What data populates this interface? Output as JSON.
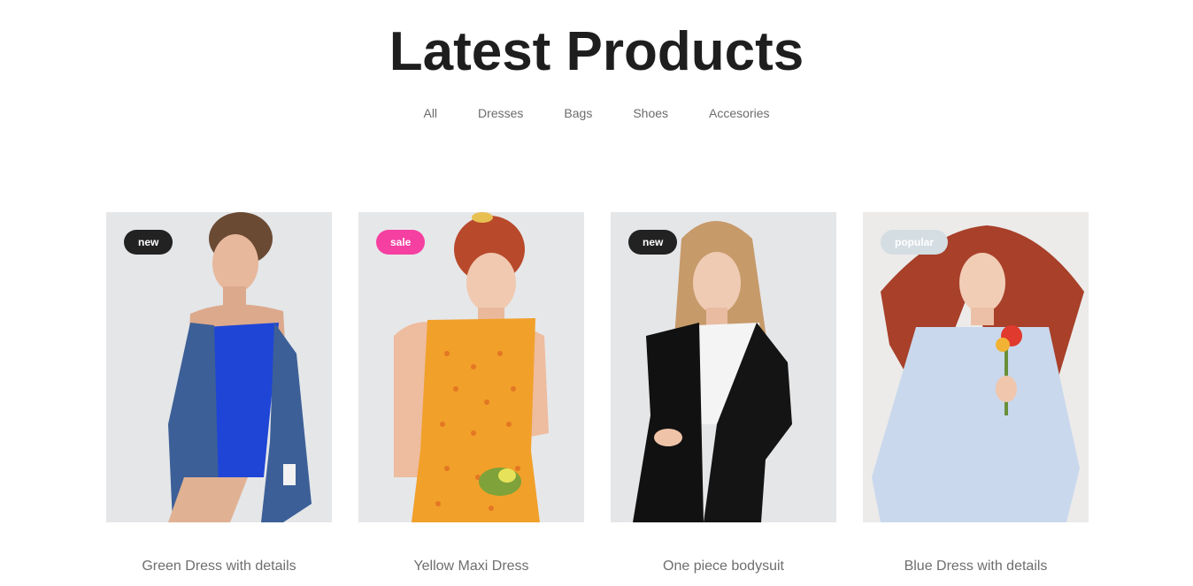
{
  "section": {
    "title": "Latest Products"
  },
  "filters": [
    {
      "label": "All"
    },
    {
      "label": "Dresses"
    },
    {
      "label": "Bags"
    },
    {
      "label": "Shoes"
    },
    {
      "label": "Accesories"
    }
  ],
  "products": [
    {
      "name": "Green Dress with details",
      "badge": "new",
      "badge_color": "#222222",
      "bg": "#e4e6e8",
      "outfit": "#1f45d6",
      "jacket": "#3c5f97",
      "hair": "#6b4a34"
    },
    {
      "name": "Yellow Maxi Dress",
      "badge": "sale",
      "badge_color": "#f53fa1",
      "bg": "#e6e7e9",
      "outfit": "#f1a02a",
      "jacket": "",
      "hair": "#b8492a"
    },
    {
      "name": "One piece bodysuit",
      "badge": "new",
      "badge_color": "#222222",
      "bg": "#e5e6e8",
      "outfit": "#f4f4f4",
      "jacket": "#111111",
      "hair": "#c79a6a"
    },
    {
      "name": "Blue Dress with details",
      "badge": "popular",
      "badge_color": "#d4dde1",
      "bg": "#ecebea",
      "outfit": "#c9d8ec",
      "jacket": "",
      "hair": "#a8402a"
    }
  ]
}
